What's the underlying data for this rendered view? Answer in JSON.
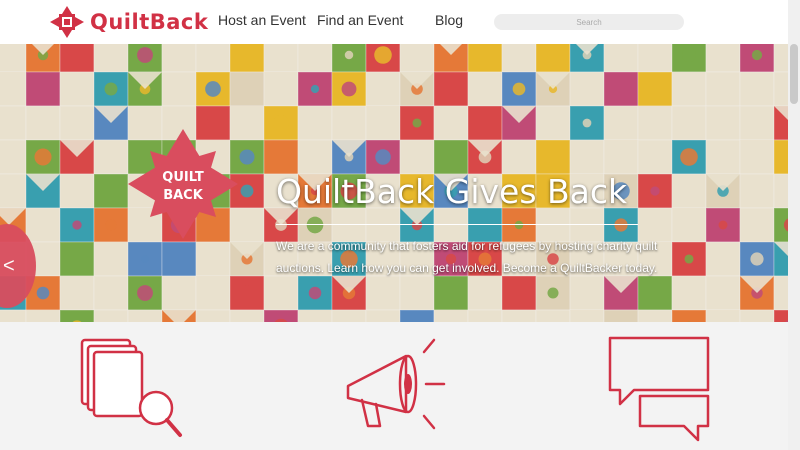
{
  "header": {
    "logo_text": "QuiltBack",
    "nav": [
      {
        "label": "Host an Event"
      },
      {
        "label": "Find an Event"
      },
      {
        "label": "Blog"
      }
    ],
    "search_placeholder": "Search"
  },
  "hero": {
    "title": "QuiltBack Gives Back",
    "description": "We are a community that fosters aid for refugees by hosting charity quilt auctions. Learn how you can get involved. Become a QuiltBacker today.",
    "badge_line1": "QUILT",
    "badge_line2": "BACK",
    "prev_arrow": "<"
  },
  "features": [
    {
      "icon": "catalog-search-icon"
    },
    {
      "icon": "megaphone-icon"
    },
    {
      "icon": "chat-bubbles-icon"
    }
  ],
  "colors": {
    "brand": "#d13145",
    "text": "#333333",
    "feature_bg": "#f3f3f3"
  }
}
